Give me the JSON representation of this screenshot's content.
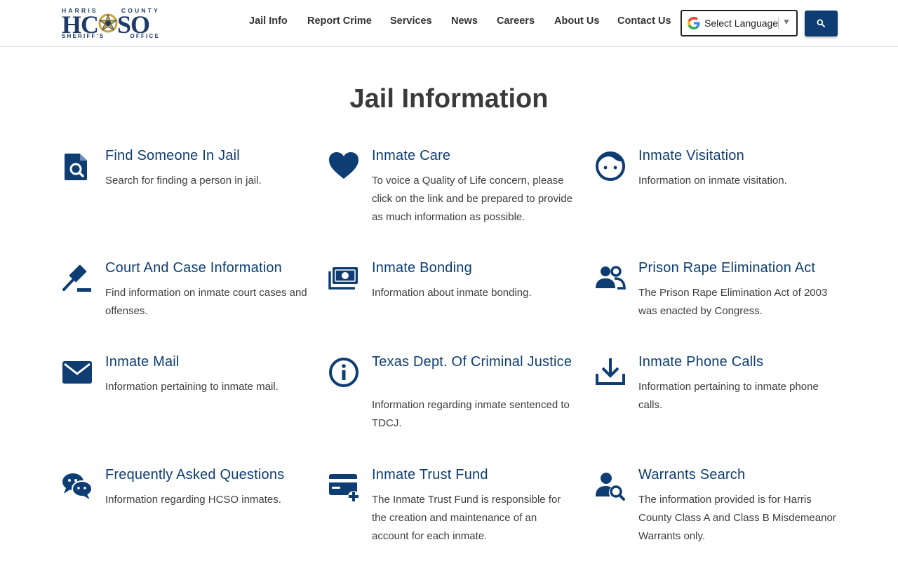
{
  "logo": {
    "top_left": "HARRIS",
    "top_right": "COUNTY",
    "main_left": "HC",
    "main_o": "O",
    "main_right": "SO",
    "bottom_left": "SHERIFF'S",
    "bottom_right": "OFFICE"
  },
  "nav": {
    "items": [
      {
        "label": "Jail Info"
      },
      {
        "label": "Report Crime"
      },
      {
        "label": "Services"
      },
      {
        "label": "News"
      },
      {
        "label": "Careers"
      },
      {
        "label": "About Us"
      },
      {
        "label": "Contact Us"
      }
    ],
    "language_label": "Select Language",
    "language_arrow": "▼"
  },
  "page": {
    "title": "Jail Information"
  },
  "cards": [
    {
      "title": "Find Someone In Jail",
      "desc": "Search for finding a person in jail.",
      "icon": "file-search-icon"
    },
    {
      "title": "Inmate Care",
      "desc": "To voice a Quality of Life concern, please click on the link and be prepared to provide as much information as possible.",
      "icon": "heart-icon"
    },
    {
      "title": "Inmate Visitation",
      "desc": "Information on inmate visitation.",
      "icon": "face-icon"
    },
    {
      "title": "Court And Case Information",
      "desc": "Find information on inmate court cases and offenses.",
      "icon": "gavel-icon"
    },
    {
      "title": "Inmate Bonding",
      "desc": "Information about inmate bonding.",
      "icon": "money-icon"
    },
    {
      "title": "Prison Rape Elimination Act",
      "desc": "The Prison Rape Elimination Act of 2003 was enacted by Congress.",
      "icon": "users-icon"
    },
    {
      "title": "Inmate Mail",
      "desc": "Information pertaining to inmate mail.",
      "icon": "envelope-icon"
    },
    {
      "title": "Texas Dept. Of Criminal Justice",
      "desc": "Information regarding inmate sentenced to TDCJ.",
      "icon": "info-icon"
    },
    {
      "title": "Inmate Phone Calls",
      "desc": "Information pertaining to inmate phone calls.",
      "icon": "download-icon"
    },
    {
      "title": "Frequently Asked Questions",
      "desc": "Information regarding HCSO inmates.",
      "icon": "chat-icon"
    },
    {
      "title": "Inmate Trust Fund",
      "desc": "The Inmate Trust Fund is responsible for the creation and maintenance of an account for each inmate.",
      "icon": "credit-card-plus-icon"
    },
    {
      "title": "Warrants Search",
      "desc": "The information provided is for Harris County Class A and Class B Misdemeanor Warrants only.",
      "icon": "user-search-icon"
    }
  ],
  "colors": {
    "brand_navy": "#0d3d73",
    "logo_gold": "#c8a43a"
  }
}
